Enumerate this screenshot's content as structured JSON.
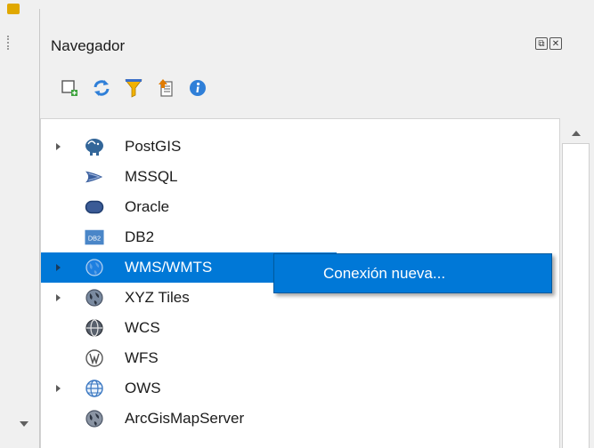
{
  "panel": {
    "title": "Navegador",
    "title_buttons": [
      {
        "icon": "float-icon",
        "glyph": "⧉"
      },
      {
        "icon": "close-icon",
        "glyph": "✕"
      }
    ]
  },
  "toolbar": [
    {
      "icon": "add-selected-layers-icon"
    },
    {
      "icon": "refresh-icon"
    },
    {
      "icon": "filter-icon"
    },
    {
      "icon": "collapse-all-icon"
    },
    {
      "icon": "info-icon"
    }
  ],
  "tree": {
    "items": [
      {
        "label": "PostGIS",
        "icon": "postgis-elephant-icon",
        "expandable": true,
        "selected": false
      },
      {
        "label": "MSSQL",
        "icon": "mssql-icon",
        "expandable": false,
        "selected": false
      },
      {
        "label": "Oracle",
        "icon": "oracle-icon",
        "expandable": false,
        "selected": false
      },
      {
        "label": "DB2",
        "icon": "db2-icon",
        "icon_text": "DB2",
        "expandable": false,
        "selected": false
      },
      {
        "label": "WMS/WMTS",
        "icon": "wms-globe-icon",
        "expandable": true,
        "selected": true
      },
      {
        "label": "XYZ Tiles",
        "icon": "xyz-globe-icon",
        "expandable": true,
        "selected": false
      },
      {
        "label": "WCS",
        "icon": "wcs-globe-icon",
        "expandable": false,
        "selected": false
      },
      {
        "label": "WFS",
        "icon": "wfs-globe-icon",
        "expandable": false,
        "selected": false
      },
      {
        "label": "OWS",
        "icon": "ows-globe-icon",
        "expandable": true,
        "selected": false
      },
      {
        "label": "ArcGisMapServer",
        "icon": "arcgis-globe-icon",
        "expandable": false,
        "selected": false
      }
    ]
  },
  "context_menu": {
    "items": [
      {
        "label": "Conexión nueva...",
        "highlighted": true
      }
    ]
  },
  "colors": {
    "selection": "#0078d7",
    "tree_background": "#ffffff",
    "panel_background": "#f0f0f0"
  }
}
